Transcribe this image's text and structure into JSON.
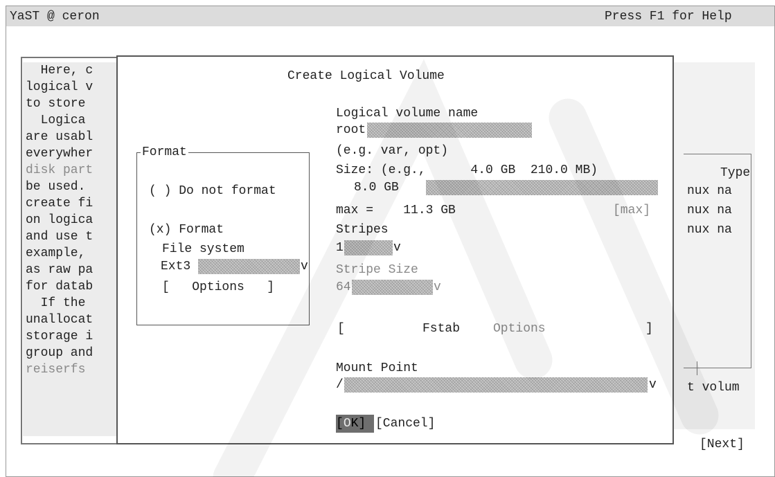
{
  "window": {
    "title": "YaST @ ceron",
    "help_hint": "Press F1 for Help"
  },
  "help_panel": {
    "lines": [
      "  Here, c",
      "logical v",
      "to store",
      "  Logica",
      "are usabl",
      "everywher",
      "disk part",
      "be used.",
      "create fi",
      "on logica",
      "and use t",
      "example,",
      "as raw pa",
      "for datab",
      "  If the",
      "unallocat",
      "storage i",
      "group and",
      "reiserfs"
    ]
  },
  "background_table": {
    "header": "Type",
    "rows": [
      "nux na",
      "nux na",
      "nux na"
    ],
    "footer": "t volum"
  },
  "dialog": {
    "title": "Create Logical Volume",
    "format_group": {
      "title": "Format",
      "do_not_format_label": "( ) Do not format",
      "format_label": "(x) Format",
      "file_system_label": "File system",
      "file_system_value": "Ext3",
      "file_system_arrow": "v",
      "options_button": "[   Options   ]"
    },
    "lv_name": {
      "label": "Logical volume name",
      "value": "root",
      "hint": "(e.g. var, opt)"
    },
    "size": {
      "label": "Size: (e.g.,      4.0 GB  210.0 MB)",
      "value": "8.0 GB",
      "max_label": "max =    11.3 GB",
      "max_button": "[max]"
    },
    "stripes": {
      "label": "Stripes",
      "value": "1",
      "arrow": "v"
    },
    "stripe_size": {
      "label": "Stripe Size",
      "value": "64",
      "arrow": "v"
    },
    "fstab_button": {
      "left": "[",
      "label_main": "Fstab",
      "label_dim": "Options",
      "right": "]"
    },
    "mount_point": {
      "label": "Mount Point",
      "value": "/",
      "arrow": "v"
    },
    "ok_button": {
      "open": "[",
      "letter": "O",
      "rest": "K]"
    },
    "cancel_button": "[Cancel]"
  },
  "next_button": "[Next]",
  "colors": {
    "titlebar": "#dcdcdc",
    "field_fill": "#c8c8c8",
    "ok_button_bg": "#6e6e6e",
    "dim_text": "#8a8a8a"
  }
}
